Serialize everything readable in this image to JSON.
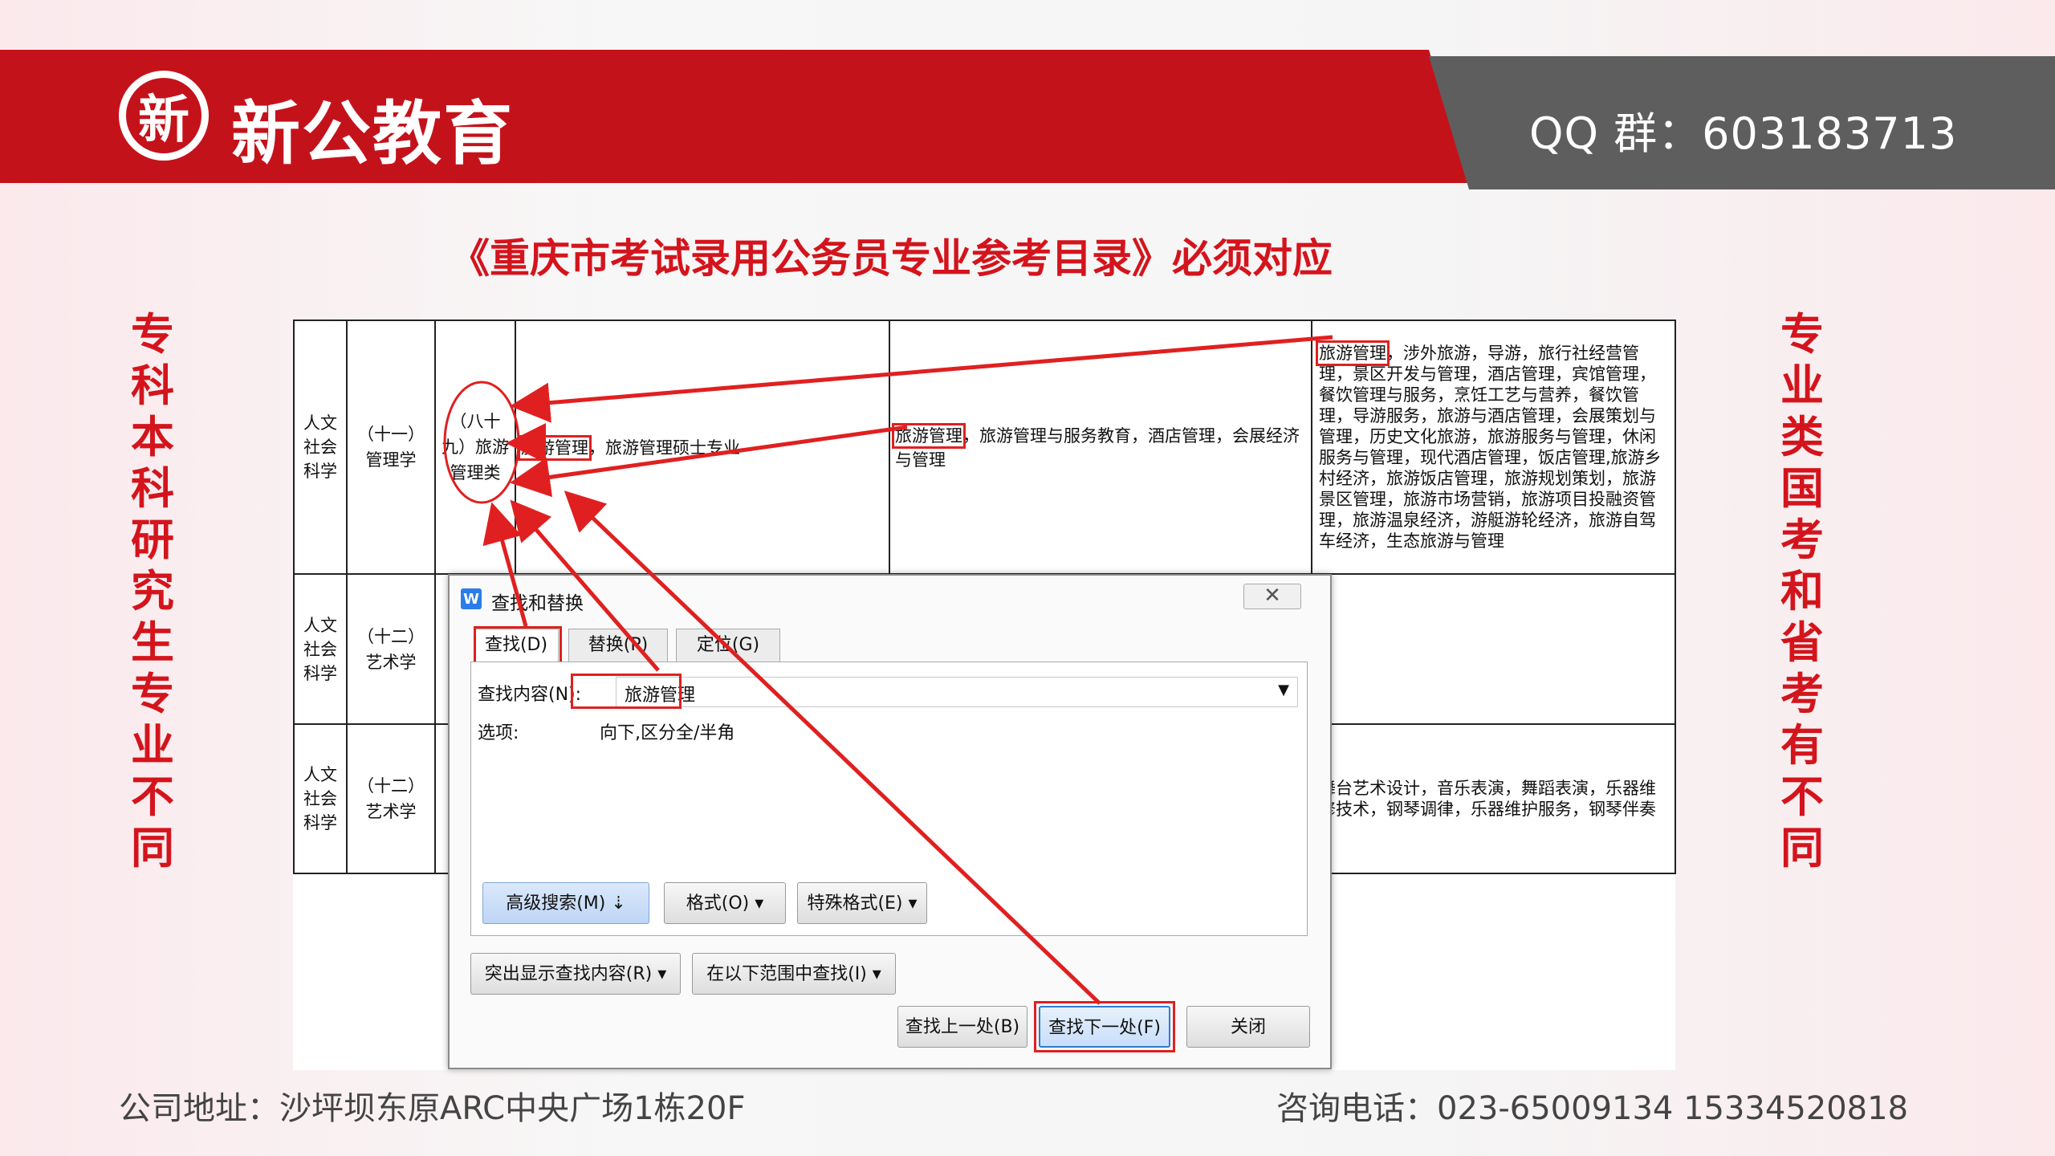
{
  "brand": {
    "logo_char": "新",
    "name": "新公教育",
    "qq": "QQ 群：603183713"
  },
  "headline": "《重庆市考试录用公务员专业参考目录》必须对应",
  "left_note": "专科本科研究生专业不同",
  "right_note": "专业类国考和省考有不同",
  "table": {
    "rows": [
      {
        "category": "人文社会科学",
        "discipline": "（十一）管理学",
        "class": "（八十九）旅游管理类",
        "graduate_major_hl": "旅游管理",
        "graduate_major_rest": "，旅游管理硕士专业",
        "undergrad_major_hl": "旅游管理",
        "undergrad_major_rest": "，旅游管理与服务教育，酒店管理，会展经济与管理",
        "college_major_hl": "旅游管理",
        "college_major_rest": "，涉外旅游，导游，旅行社经营管理，景区开发与管理，酒店管理，宾馆管理，餐饮管理与服务，烹饪工艺与营养，餐饮管理，导游服务，旅游与酒店管理，会展策划与管理，历史文化旅游，旅游服务与管理，休闲服务与管理，现代酒店管理，饭店管理,旅游乡村经济，旅游饭店管理，旅游规划策划，旅游景区管理，旅游市场营销，旅游项目投融资管理，旅游温泉经济，游艇游轮经济，旅游自驾车经济，生态旅游与管理"
      },
      {
        "category": "人文社会科学",
        "discipline": "（十二）艺术学",
        "college_major": ""
      },
      {
        "category": "人文社会科学",
        "discipline": "（十二）艺术学",
        "college_major": "舞台艺术设计，音乐表演，舞蹈表演，乐器维修技术，钢琴调律，乐器维护服务，钢琴伴奏"
      }
    ]
  },
  "dialog": {
    "icon": "W",
    "title": "查找和替换",
    "tabs": [
      "查找(D)",
      "替换(P)",
      "定位(G)"
    ],
    "find_label": "查找内容(N):",
    "find_value": "旅游管理",
    "options_label": "选项:",
    "options_value": "向下,区分全/半角",
    "advanced_search": "高级搜索(M)",
    "format": "格式(O)",
    "special_format": "特殊格式(E)",
    "highlight_found": "突出显示查找内容(R)",
    "find_in": "在以下范围中查找(I)",
    "find_prev": "查找上一处(B)",
    "find_next": "查找下一处(F)",
    "close": "关闭"
  },
  "footer": {
    "address": "公司地址：沙坪坝东原ARC中央广场1栋20F",
    "phone": "咨询电话：023-65009134   15334520818"
  },
  "colors": {
    "brand_red": "#c4121b",
    "banner_gray": "#5e5e5e",
    "annotation_red": "#e02020"
  }
}
